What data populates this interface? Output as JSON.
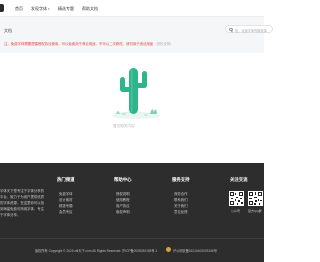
{
  "nav": {
    "items": [
      {
        "label": "首页"
      },
      {
        "label": "发现字体",
        "has_dropdown": true
      },
      {
        "label": "精选专题"
      },
      {
        "label": "帮助文档"
      }
    ]
  },
  "subbar": {
    "breadcrumb": "文档",
    "search_placeholder": "如，欢速字体的微笑体",
    "notice": "注，免费字体需要遵循授权协议使用，可以免费用于商业用途，不可以二次修改，请勿用于违法用途",
    "notice_suffix": "（授权说明）"
  },
  "empty_state": {
    "text": "暂无相关内容"
  },
  "footer": {
    "about": "字体天下是专注于字体分享的平台，致力于为用户提供优质的字体资源，在这里你可以找到海量免费可商用字体，专注于字体分享。",
    "columns": [
      {
        "title": "热门频道",
        "links": [
          "免费字体",
          "设计素材",
          "精选专题",
          "会员专区"
        ]
      },
      {
        "title": "帮助中心",
        "links": [
          "授权说明",
          "使用教程",
          "用户协议",
          "版权声明"
        ]
      },
      {
        "title": "服务支持",
        "links": [
          "商务合作",
          "联系我们",
          "关于我们",
          "意见反馈"
        ]
      },
      {
        "title": "关注交流",
        "links": []
      }
    ],
    "qr_labels": [
      "公众号",
      "官方QQ群"
    ],
    "copyright": "版权所有 Copyright © 2025 ziti天下.com All Rights Reserved.",
    "icp": "沪ICP备2025030155号-1",
    "beian": "沪公网安备31010402003156号"
  },
  "colors": {
    "notice": "#e23d3d",
    "footer_bg": "#2d2d2d",
    "subbar_bg": "#f5f6f8"
  }
}
